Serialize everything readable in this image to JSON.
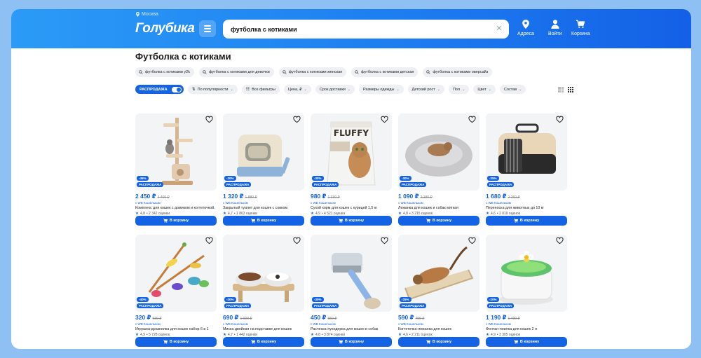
{
  "header": {
    "city": "Москва",
    "logo": "Голубика",
    "search_value": "футболка с котиками",
    "nav": [
      {
        "label": "Адреса",
        "icon": "location-pin-icon"
      },
      {
        "label": "Войти",
        "icon": "user-icon"
      },
      {
        "label": "Корзина",
        "icon": "cart-icon"
      }
    ]
  },
  "page_title": "Футболка с котиками",
  "chips": [
    "футболка с котиками y2k",
    "футболка с котиками для девочки",
    "футболка с котиками женская",
    "футболка с котиками детская",
    "футболка с котиками оверсайз"
  ],
  "filters": {
    "sale": "РАСПРОДАЖА",
    "sort": "По популярности",
    "all": "Все фильтры",
    "items": [
      "Цена, ₽",
      "Срок доставки",
      "Размеры одежды",
      "Детский рост",
      "Пол",
      "Цвет",
      "Состав"
    ]
  },
  "colors": {
    "accent": "#1463e5",
    "header_start": "#2b9bf7",
    "header_end": "#1460e6"
  },
  "cart_label": "В корзину",
  "sale_badge": "РАСПРОДАЖА",
  "products": [
    {
      "price": "2 450 ₽",
      "old": "4 460 ₽",
      "discount": "-45%",
      "seller": "с WB Кошельком",
      "name": "Комплекс для кошек с домиком и когтеточкой.",
      "rating": "4,8",
      "reviews": "• 2 342 оценки"
    },
    {
      "price": "1 320 ₽",
      "old": "1 880 ₽",
      "discount": "-30%",
      "seller": "с WB Кошельком",
      "name": "Закрытый туалет для кошек с совком",
      "rating": "4,7",
      "reviews": "• 1 863 оценки"
    },
    {
      "price": "980 ₽",
      "old": "1 330 ₽",
      "discount": "-30%",
      "seller": "с WB Кошельком",
      "name": "Сухой корм для кошек с курицей 1,5 кг",
      "rating": "4,9",
      "reviews": "• 4 521 оценка"
    },
    {
      "price": "1 090 ₽",
      "old": "2 180 ₽",
      "discount": "-30%",
      "seller": "с WB Кошельком",
      "name": "Лежанка для кошек и собак мягкая",
      "rating": "4,8",
      "reviews": "• 3 215 оценок"
    },
    {
      "price": "1 680 ₽",
      "old": "2 260 ₽",
      "discount": "-25%",
      "seller": "с WB Кошельком",
      "name": "Переноска для животных до 10 кг",
      "rating": "4,6",
      "reviews": "• 2 019 оценок"
    },
    {
      "price": "320 ₽",
      "old": "530 ₽",
      "discount": "-40%",
      "seller": "с WB Кошельком",
      "name": "Игрушка-дразнилка для кошек набор 6 в 1",
      "rating": "4,9",
      "reviews": "• 5 728 оценок"
    },
    {
      "price": "690 ₽",
      "old": "1 000 ₽",
      "discount": "-30%",
      "seller": "с WB Кошельком",
      "name": "Миска двойная на подставке для кошек",
      "rating": "4,7",
      "reviews": "• 1 442 оценки"
    },
    {
      "price": "450 ₽",
      "old": "650 ₽",
      "discount": "-30%",
      "seller": "с WB Кошельком",
      "name": "Расческа-пуходерка для кошек и собак",
      "rating": "4,8",
      "reviews": "• 3 874 оценки"
    },
    {
      "price": "590 ₽",
      "old": "790 ₽",
      "discount": "-25%",
      "seller": "с WB Кошельком",
      "name": "Когтеточка-лежанка для кошек",
      "rating": "4,6",
      "reviews": "• 2 211 оценок"
    },
    {
      "price": "1 190 ₽",
      "old": "1 490 ₽",
      "discount": "-20%",
      "seller": "с WB Кошельком",
      "name": "Фонтан-поилка для кошек 2 л",
      "rating": "4,9",
      "reviews": "• 3 305 оценок"
    }
  ]
}
